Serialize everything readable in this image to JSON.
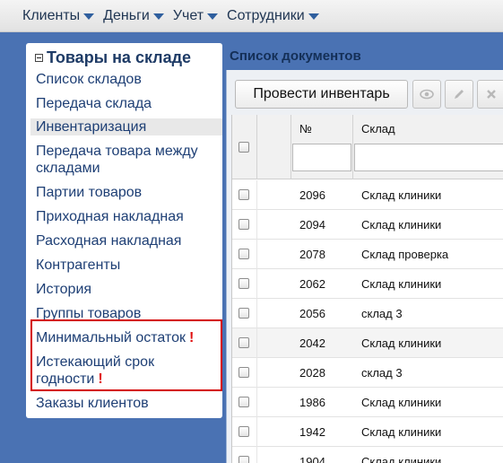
{
  "top_menu": [
    {
      "label": "Клиенты"
    },
    {
      "label": "Деньги"
    },
    {
      "label": "Учет"
    },
    {
      "label": "Сотрудники"
    }
  ],
  "sidebar": {
    "title": "Товары на складе",
    "items": [
      {
        "label": "Список складов"
      },
      {
        "label": "Передача склада"
      },
      {
        "label": "Инвентаризация"
      },
      {
        "label": "Передача товара между складами"
      },
      {
        "label": "Партии товаров"
      },
      {
        "label": "Приходная накладная"
      },
      {
        "label": "Расходная накладная"
      },
      {
        "label": "Контрагенты"
      },
      {
        "label": "История"
      },
      {
        "label": "Группы товаров"
      },
      {
        "label": "Минимальный остаток"
      },
      {
        "label": "Истекающий срок годности"
      },
      {
        "label": "Заказы клиентов"
      }
    ],
    "alert_mark": "!"
  },
  "documents": {
    "title": "Список документов",
    "toolbar": {
      "primary_button": "Провести инвентарь",
      "icons": [
        "eye-icon",
        "pencil-icon",
        "close-icon"
      ]
    },
    "columns": {
      "number": "№",
      "warehouse": "Склад"
    },
    "rows": [
      {
        "number": "2096",
        "warehouse": "Склад клиники"
      },
      {
        "number": "2094",
        "warehouse": "Склад клиники"
      },
      {
        "number": "2078",
        "warehouse": "Склад проверка"
      },
      {
        "number": "2062",
        "warehouse": "Склад клиники"
      },
      {
        "number": "2056",
        "warehouse": "склад 3"
      },
      {
        "number": "2042",
        "warehouse": "Склад клиники"
      },
      {
        "number": "2028",
        "warehouse": "склад 3"
      },
      {
        "number": "1986",
        "warehouse": "Склад клиники"
      },
      {
        "number": "1942",
        "warehouse": "Склад клиники"
      },
      {
        "number": "1904",
        "warehouse": "Склад клиники"
      }
    ]
  },
  "colors": {
    "background": "#4a72b3",
    "alert": "#e01010",
    "highlight_border": "#d40000"
  }
}
